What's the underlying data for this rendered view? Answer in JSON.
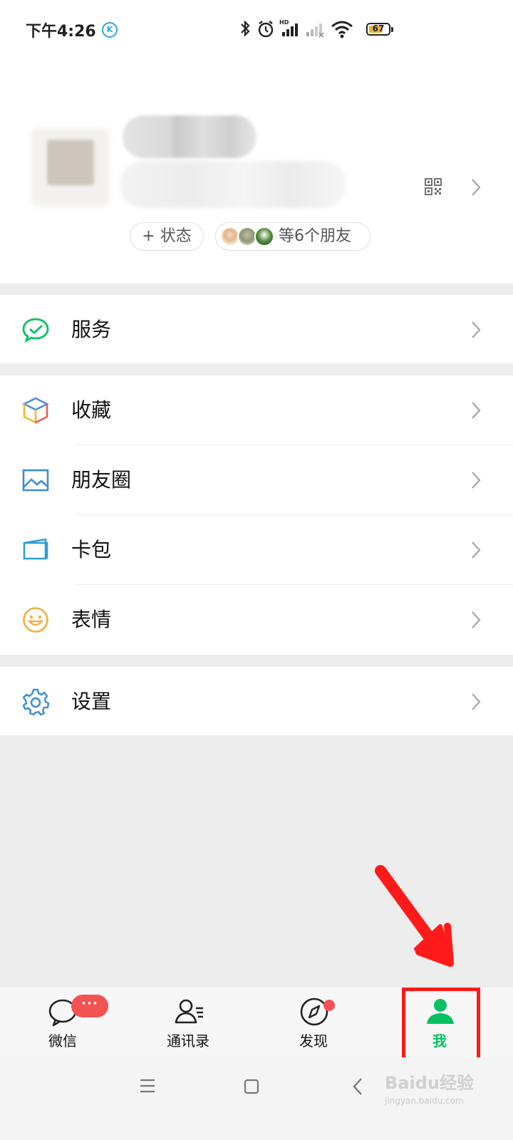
{
  "status_bar": {
    "time": "下午4:26",
    "k_badge": "K",
    "network_label": "HD",
    "battery": "67",
    "battery_level": 0.67
  },
  "profile": {
    "status_button": "+ 状态",
    "friends_button": "等6个朋友",
    "icons": [
      "qr-code-icon",
      "chevron-right-icon"
    ]
  },
  "menu": {
    "service": {
      "label": "服务",
      "icon": "wechat-pay-icon"
    },
    "favorites": {
      "label": "收藏",
      "icon": "cube-icon"
    },
    "moments": {
      "label": "朋友圈",
      "icon": "picture-icon"
    },
    "cards": {
      "label": "卡包",
      "icon": "card-wallet-icon"
    },
    "stickers": {
      "label": "表情",
      "icon": "smiley-icon"
    },
    "settings": {
      "label": "设置",
      "icon": "gear-icon"
    }
  },
  "tabbar": {
    "chats": {
      "label": "微信",
      "badge": "···"
    },
    "contacts": {
      "label": "通讯录"
    },
    "discover": {
      "label": "发现"
    },
    "me": {
      "label": "我"
    }
  },
  "colors": {
    "accent": "#07c160",
    "badge": "#f35252",
    "highlight": "#ff1a1a"
  },
  "watermark": {
    "brand": "Baidu经验",
    "url": "jingyan.baidu.com"
  }
}
